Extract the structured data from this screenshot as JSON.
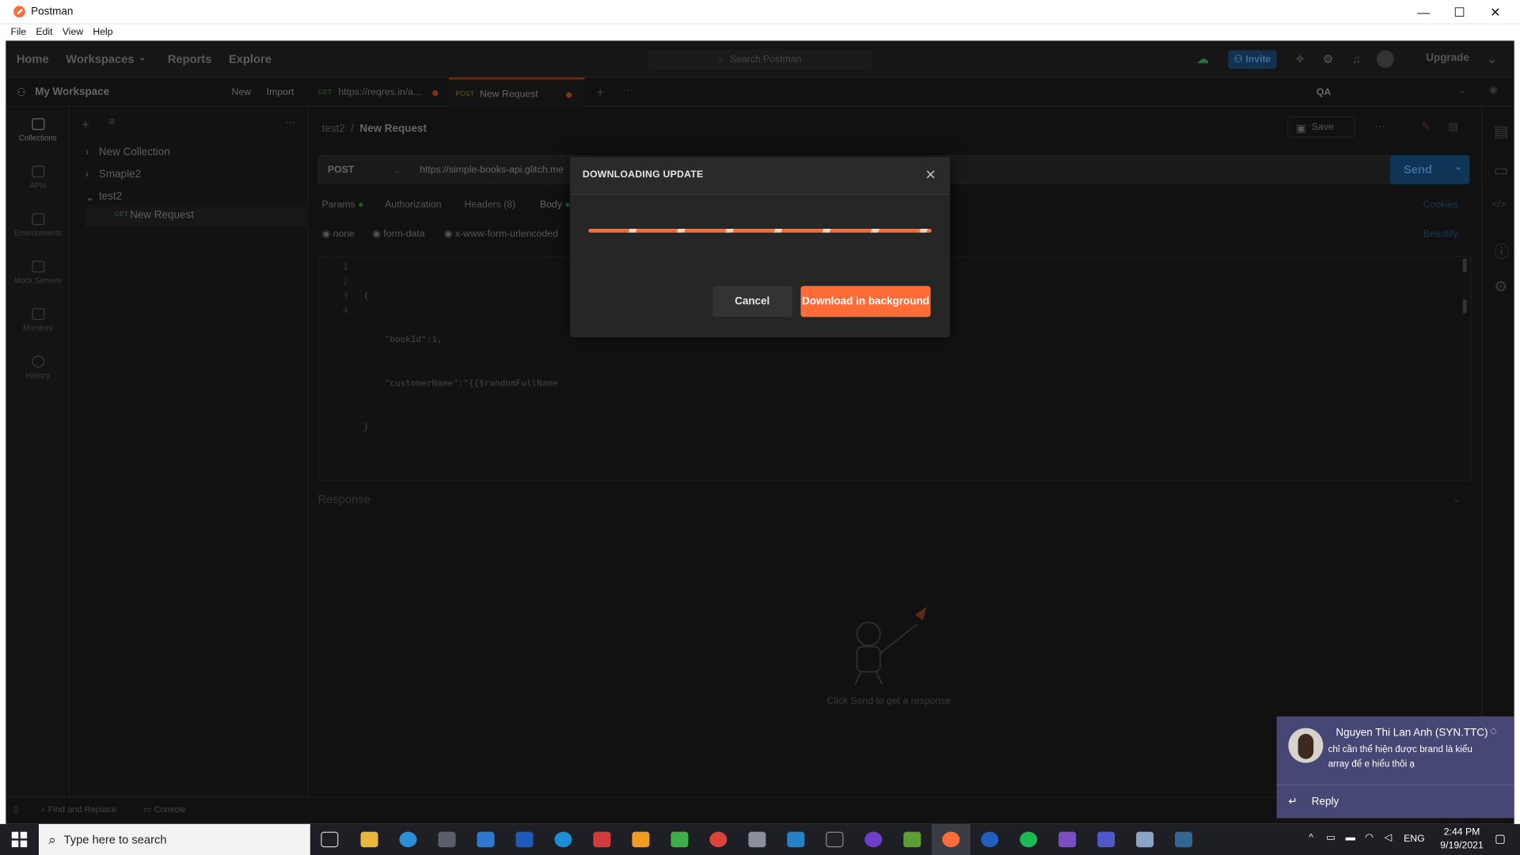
{
  "window": {
    "title": "Postman",
    "minimize": "—",
    "maximize": "☐",
    "close": "✕"
  },
  "menu": [
    "File",
    "Edit",
    "View",
    "Help"
  ],
  "topnav": {
    "home": "Home",
    "workspaces": "Workspaces",
    "reports": "Reports",
    "explore": "Explore",
    "search_placeholder": "Search Postman",
    "invite": "Invite",
    "upgrade": "Upgrade"
  },
  "workspace": {
    "name": "My Workspace",
    "new": "New",
    "import": "Import"
  },
  "rail": [
    "Collections",
    "APIs",
    "Environments",
    "Mock Servers",
    "Monitors",
    "History"
  ],
  "collections": {
    "items": [
      "New Collection",
      "Smaple2",
      "test2"
    ],
    "request": {
      "method": "GET",
      "name": "New Request"
    }
  },
  "tabs": [
    {
      "method": "GET",
      "title": "https://reqres.in/a..."
    },
    {
      "method": "POST",
      "title": "New Request"
    }
  ],
  "env": "QA",
  "request": {
    "breadcrumb_parent": "test2",
    "breadcrumb_sep": "/",
    "breadcrumb_current": "New Request",
    "save": "Save",
    "method": "POST",
    "url": "https://simple-books-api.glitch.me",
    "send": "Send",
    "cookies": "Cookies",
    "beautify": "Beautify",
    "tabs": [
      "Params",
      "Authorization",
      "Headers (8)",
      "Body"
    ],
    "body_modes": [
      "none",
      "form-data",
      "x-www-form-urlencoded"
    ],
    "code": [
      {
        "num": "1",
        "text": "{"
      },
      {
        "num": "2",
        "text": "    \"bookId\":1,"
      },
      {
        "num": "3",
        "text": "    \"customerName\":\"{{$randomFullName"
      },
      {
        "num": "4",
        "text": "}"
      }
    ]
  },
  "response": {
    "label": "Response",
    "empty": "Click Send to get a response"
  },
  "statusbar": {
    "find": "Find and Replace",
    "console": "Console"
  },
  "dialog": {
    "title": "DOWNLOADING UPDATE",
    "progress": 1.0,
    "cancel": "Cancel",
    "download_bg": "Download in background"
  },
  "taskbar": {
    "search_placeholder": "Type here to search",
    "lang": "ENG",
    "time": "2:44 PM",
    "date": "9/19/2021"
  },
  "toast": {
    "sender": "Nguyen Thi Lan Anh (SYN.TTC)",
    "message": "chỉ cần thể hiện được brand là kiểu array để e hiểu thôi ạ",
    "reply": "Reply"
  },
  "colors": {
    "accent": "#ff6c37",
    "send": "#0f3556",
    "teams": "#464775"
  }
}
